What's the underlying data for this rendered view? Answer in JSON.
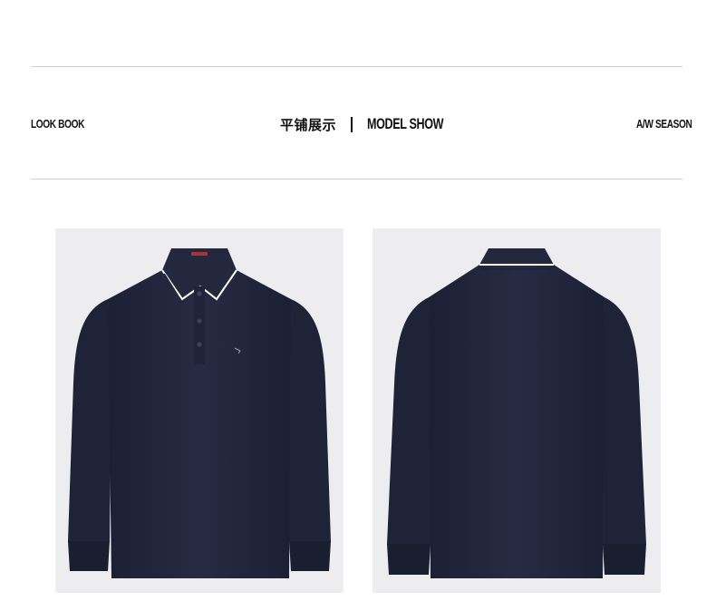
{
  "header": {
    "left_label": "LOOK BOOK",
    "center_cn": "平铺展示",
    "center_en": "MODEL SHOW",
    "right_label": "A/W SEASON"
  },
  "products": [
    {
      "view": "front",
      "color": "#23283f",
      "trim": "#ffffff"
    },
    {
      "view": "back",
      "color": "#23283f",
      "trim": "#ffffff"
    }
  ],
  "colors": {
    "background": "#ffffff",
    "rule": "#cfcfcf",
    "photo_bg": "#ededef",
    "text": "#111111"
  }
}
